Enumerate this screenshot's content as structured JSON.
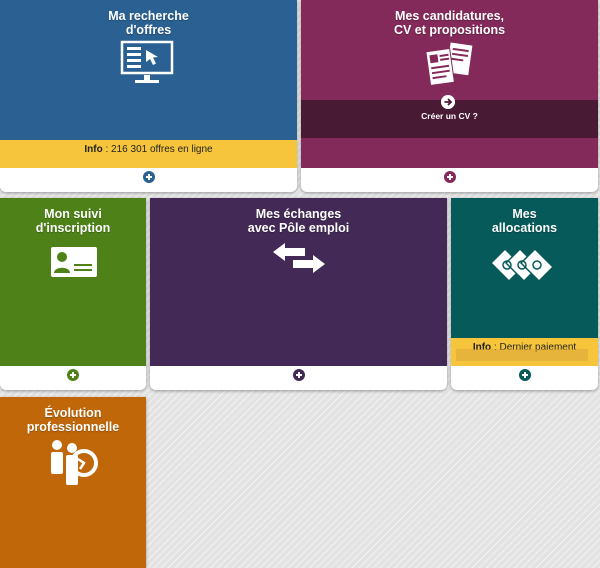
{
  "tiles": {
    "offres": {
      "title_line1": "Ma recherche",
      "title_line2": "d'offres",
      "info_label": "Info",
      "info_text": " : 216 301 offres en ligne",
      "icon": "computer-touch-icon",
      "color": "#2b6092"
    },
    "candidatures": {
      "title_line1": "Mes candidatures,",
      "title_line2": "CV et propositions",
      "cv_link": "Créer un CV ?",
      "icon": "documents-icon",
      "color": "#832a5a"
    },
    "inscription": {
      "title_line1": "Mon suivi",
      "title_line2": "d'inscription",
      "icon": "id-card-icon",
      "color": "#4e8218"
    },
    "echanges": {
      "title_line1": "Mes échanges",
      "title_line2": "avec Pôle emploi",
      "icon": "exchange-arrows-icon",
      "color": "#432a56"
    },
    "allocations": {
      "title_line1": "Mes",
      "title_line2": "allocations",
      "info_label": "Info",
      "info_text": " : Dernier paiement",
      "icon": "money-notes-icon",
      "color": "#075a5a"
    },
    "evolution": {
      "title_line1": "Évolution",
      "title_line2": "professionnelle",
      "icon": "career-evolution-icon",
      "color": "#c06709"
    }
  }
}
